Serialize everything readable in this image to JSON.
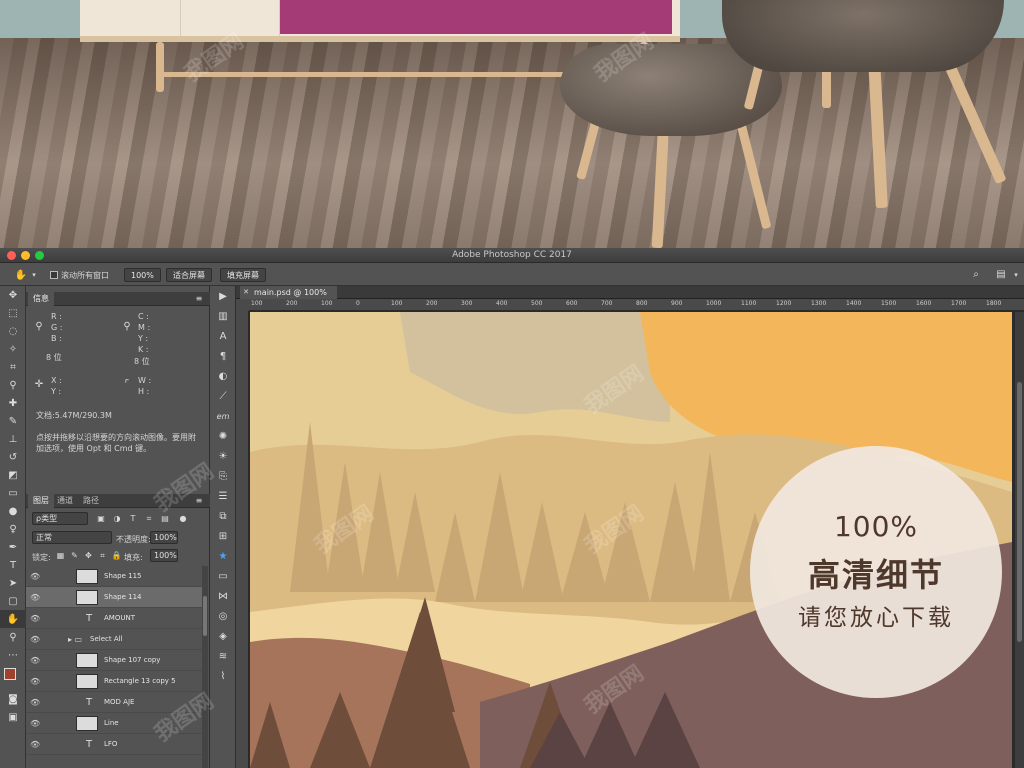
{
  "window": {
    "title": "Adobe Photoshop CC 2017",
    "traffic_lights": [
      "#ff5f57",
      "#febc2e",
      "#28c840"
    ]
  },
  "options_bar": {
    "tool_icon": "hand-icon",
    "scroll_all_windows": "滚动所有窗口",
    "zoom": "100%",
    "fit_screen": "适合屏幕",
    "fill_screen": "填充屏幕"
  },
  "info_panel": {
    "tab": "信息",
    "rgb_labels": [
      "R :",
      "G :",
      "B :"
    ],
    "cmyk_labels": [
      "C :",
      "M :",
      "Y :",
      "K :"
    ],
    "bit_left": "8 位",
    "bit_right": "8 位",
    "xy_labels": [
      "X :",
      "Y :"
    ],
    "wh_labels": [
      "W :",
      "H :"
    ],
    "doc_size": "文档:5.47M/290.3M",
    "hint": "点按并拖移以沿想要的方向滚动图像。要用附加选项，使用 Opt 和 Cmd 键。"
  },
  "layers_panel": {
    "tabs": [
      "图层",
      "通道",
      "路径"
    ],
    "filter_kind": "ρ类型",
    "blend_mode": "正常",
    "opacity_label": "不透明度:",
    "opacity_value": "100%",
    "lock_label": "锁定:",
    "fill_label": "填充:",
    "fill_value": "100%",
    "layers": [
      {
        "name": "Shape 115",
        "type": "image",
        "selected": false
      },
      {
        "name": "Shape 114",
        "type": "image",
        "selected": true
      },
      {
        "name": "AMOUNT",
        "type": "text",
        "selected": false
      },
      {
        "name": "Select All",
        "type": "group",
        "selected": false
      },
      {
        "name": "Shape 107 copy",
        "type": "image",
        "selected": false
      },
      {
        "name": "Rectangle 13 copy 5",
        "type": "image",
        "selected": false
      },
      {
        "name": "MOD AJE",
        "type": "text",
        "selected": false
      },
      {
        "name": "Line",
        "type": "image",
        "selected": false
      },
      {
        "name": "LFO",
        "type": "text",
        "selected": false
      }
    ]
  },
  "document": {
    "tab_title": "main.psd @ 100%",
    "ruler_ticks": [
      "100",
      "200",
      "100",
      "0",
      "100",
      "200",
      "300",
      "400",
      "500",
      "600",
      "700",
      "800",
      "900",
      "1000",
      "1100",
      "1200",
      "1300",
      "1400",
      "1500",
      "1600",
      "1700",
      "1800"
    ]
  },
  "badge": {
    "percent": "100%",
    "headline": "高清细节",
    "subline": "请您放心下载"
  },
  "watermark_text": "我图网",
  "colors": {
    "ps_chrome": "#535353",
    "panel_dark": "#3e3e3e",
    "foreground_swatch": "#a0412b",
    "sun": "#f3b65a",
    "mountain_purple": "#7e5f5b"
  }
}
